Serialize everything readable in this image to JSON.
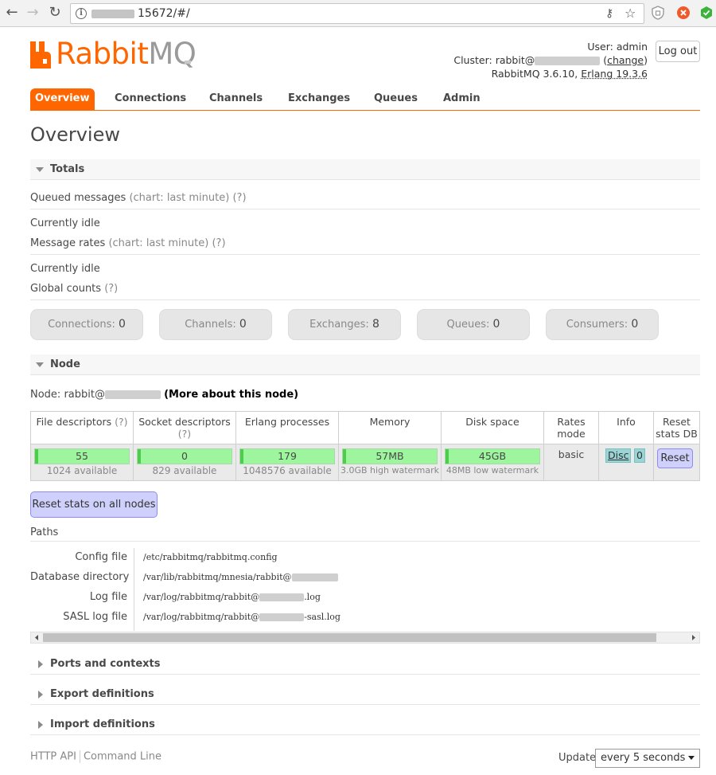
{
  "colors": {
    "brand": "#ff6600",
    "logo_grey": "#9a9a9a",
    "section_bg": "#f7f7f7",
    "bar_fill": "#9df59d",
    "bar_lead": "#4ccd4c",
    "info_tag": "#9ad5d5",
    "button": "#cfd0fb",
    "button_border": "#8d8df0",
    "count_box": "#e6e6e6"
  },
  "icons": {
    "back": "back-arrow-icon",
    "forward": "forward-arrow-icon",
    "reload": "reload-icon",
    "site_info": "info-icon",
    "key": "key-icon",
    "bookmark": "star-icon",
    "logo": "rabbit-logo-icon",
    "collapse": "triangle-down-icon",
    "expand": "triangle-right-icon",
    "dropdown": "chevron-down-icon"
  },
  "browser": {
    "url": "15672/#/"
  },
  "header": {
    "logo_rabbit": "Rabbit",
    "logo_mq": "MQ",
    "user_label": "User:",
    "user_value": "admin",
    "cluster_label": "Cluster:",
    "cluster_value": "rabbit@",
    "change_label": "change",
    "version_text": "RabbitMQ 3.6.10,",
    "erlang_text": "Erlang 19.3.6",
    "logout_label": "Log out"
  },
  "nav": {
    "tabs": [
      "Overview",
      "Connections",
      "Channels",
      "Exchanges",
      "Queues",
      "Admin"
    ],
    "active": "Overview"
  },
  "page_title": "Overview",
  "totals": {
    "title": "Totals",
    "queued_label": "Queued messages",
    "queued_chart": "(chart: last minute)",
    "queued_help": "(?)",
    "queued_status": "Currently idle",
    "rates_label": "Message rates",
    "rates_chart": "(chart: last minute)",
    "rates_help": "(?)",
    "rates_status": "Currently idle",
    "global_label": "Global counts",
    "global_help": "(?)",
    "counts": [
      {
        "label": "Connections:",
        "value": "0"
      },
      {
        "label": "Channels:",
        "value": "0"
      },
      {
        "label": "Exchanges:",
        "value": "8"
      },
      {
        "label": "Queues:",
        "value": "0"
      },
      {
        "label": "Consumers:",
        "value": "0"
      }
    ]
  },
  "node": {
    "title": "Node",
    "node_prefix": "Node: rabbit@",
    "more_link": "(More about this node)",
    "headers": {
      "file_desc": "File descriptors",
      "file_help": "(?)",
      "socket_desc": "Socket descriptors",
      "socket_help": "(?)",
      "erlang_proc": "Erlang processes",
      "memory": "Memory",
      "disk": "Disk space",
      "rates_mode_1": "Rates",
      "rates_mode_2": "mode",
      "info": "Info",
      "reset_1": "Reset",
      "reset_2": "stats DB"
    },
    "values": {
      "file_desc": "55",
      "file_avail": "1024 available",
      "socket_desc": "0",
      "socket_avail": "829 available",
      "erlang_proc": "179",
      "erlang_avail": "1048576 available",
      "memory": "57MB",
      "memory_wm": "3.0GB high watermark",
      "disk": "45GB",
      "disk_wm": "48MB low watermark",
      "rates_mode": "basic",
      "info_disc": "Disc",
      "info_count": "0",
      "reset": "Reset"
    },
    "reset_all": "Reset stats on all nodes"
  },
  "paths": {
    "title": "Paths",
    "rows": [
      {
        "label": "Config file",
        "value": "/etc/rabbitmq/rabbitmq.config",
        "suffix": ""
      },
      {
        "label": "Database directory",
        "value": "/var/lib/rabbitmq/mnesia/rabbit@",
        "suffix": ""
      },
      {
        "label": "Log file",
        "value": "/var/log/rabbitmq/rabbit@",
        "suffix": ".log"
      },
      {
        "label": "SASL log file",
        "value": "/var/log/rabbitmq/rabbit@",
        "suffix": "-sasl.log"
      }
    ]
  },
  "collapsed": {
    "ports": "Ports and contexts",
    "export": "Export definitions",
    "import": "Import definitions"
  },
  "footer": {
    "http_api": "HTTP API",
    "command_line": "Command Line",
    "update_label": "Update",
    "update_value": "every 5 seconds"
  }
}
